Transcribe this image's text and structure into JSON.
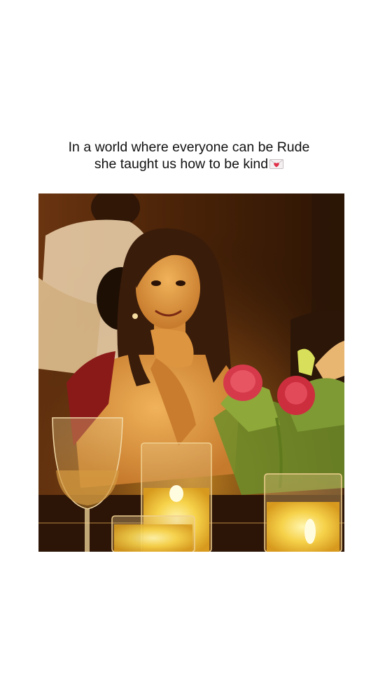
{
  "caption": {
    "line1": "In a world where everyone can be Rude",
    "line2": "she taught us how to be kind",
    "emoji": "love-letter-icon"
  },
  "photo": {
    "subject": "woman-smiling-at-candlelit-dinner-table",
    "icons": [
      "wine-glass-icon",
      "candle-icon",
      "rose-bouquet-icon"
    ]
  },
  "colors": {
    "background": "#ffffff",
    "text": "#111111",
    "warm_light": "#f3c13a",
    "dark_wood": "#3a1c08",
    "rose": "#d63a4a"
  }
}
